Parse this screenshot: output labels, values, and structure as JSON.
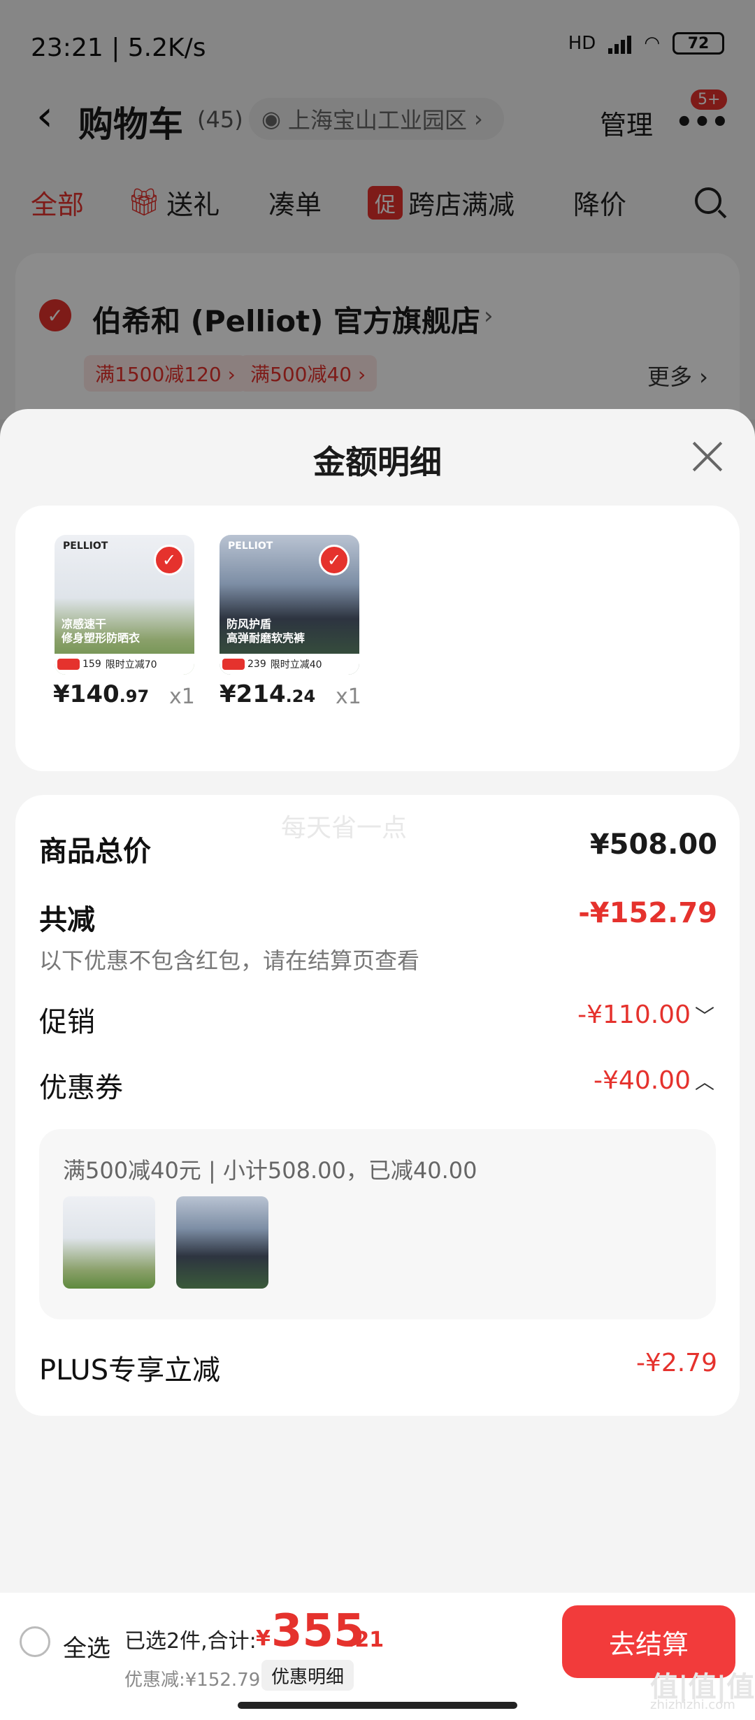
{
  "status_bar": {
    "time_speed": "23:21 | 5.2K/s",
    "network": "HD",
    "battery": "72"
  },
  "header": {
    "title": "购物车",
    "count": "(45)",
    "location": "上海宝山工业园区",
    "manage": "管理",
    "badge": "5+"
  },
  "filters": [
    "全部",
    "送礼",
    "凑单",
    "促",
    "跨店满减",
    "降价"
  ],
  "store": {
    "name": "伯希和 (Pelliot) 官方旗舰店",
    "coupons": [
      "满1500减120 ›",
      "满500减40 ›"
    ],
    "more": "更多 ›"
  },
  "sheet": {
    "title": "金额明细",
    "watermark": "每天省一点",
    "products": [
      {
        "brand": "PELLIOT",
        "img_text": "凉感速干\n修身塑形防晒衣",
        "img_price": "159",
        "img_promo": "限时立减70",
        "price_main": "¥140",
        "price_cents": ".97",
        "qty": "x1"
      },
      {
        "brand": "PELLIOT",
        "img_text": "防风护盾\n高弹耐磨软壳裤",
        "img_price": "239",
        "img_promo": "限时立减40",
        "price_main": "¥214",
        "price_cents": ".24",
        "qty": "x1"
      }
    ],
    "rows": {
      "total_label": "商品总价",
      "total_value": "¥508.00",
      "reduce_label": "共减",
      "reduce_value": "-¥152.79",
      "reduce_note": "以下优惠不包含红包，请在结算页查看",
      "promo_label": "促销",
      "promo_value": "-¥110.00",
      "coupon_label": "优惠券",
      "coupon_value": "-¥40.00",
      "coupon_detail": "满500减40元 | 小计508.00，已减40.00",
      "plus_label": "PLUS专享立减",
      "plus_value": "-¥2.79"
    }
  },
  "bottom": {
    "select_all": "全选",
    "summary": "已选2件,合计:",
    "currency": "¥",
    "total_main": "355",
    "total_cents": ".21",
    "discount": "优惠减:¥152.79",
    "detail_button": "优惠明细",
    "checkout": "去结算"
  },
  "site_mark": "值|值|值",
  "site_url": "zhizhizhi.com",
  "colors": {
    "accent": "#e5322d",
    "checkout": "#f23b3b"
  }
}
